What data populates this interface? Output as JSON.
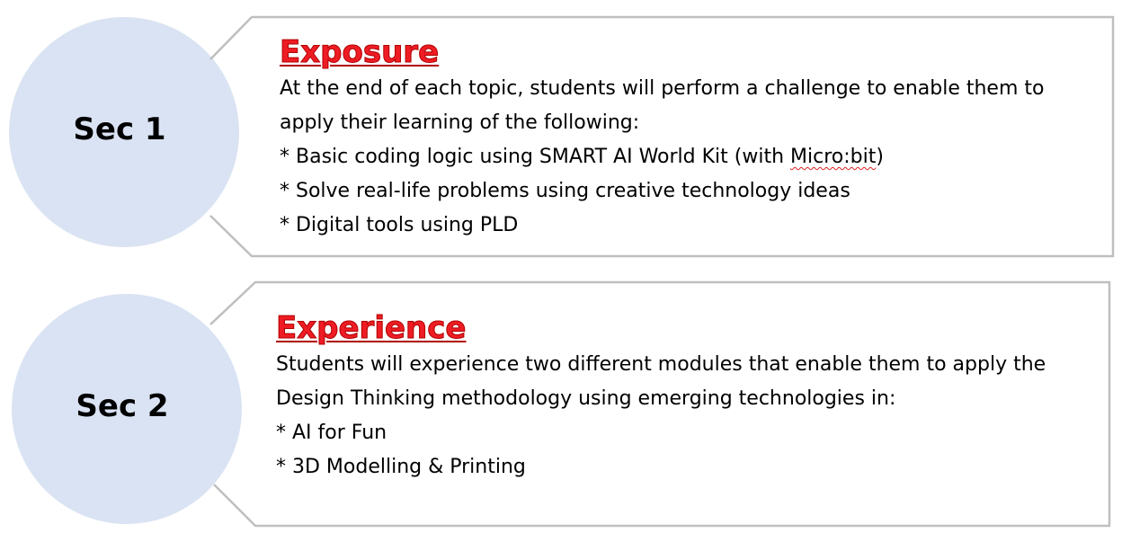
{
  "sections": [
    {
      "circle_label": "Sec 1",
      "title": "Exposure",
      "intro_1": "At the end of each topic, students will perform a challenge to enable them to",
      "intro_2": "apply their learning of the following:",
      "bullet_1_pre": "* Basic coding logic using SMART AI World Kit (with ",
      "bullet_1_flagged": "Micro:bit",
      "bullet_1_post": ")",
      "bullet_2": "* Solve real-life problems using creative technology ideas",
      "bullet_3": "* Digital tools using PLD"
    },
    {
      "circle_label": "Sec 2",
      "title": "Experience",
      "intro_1": "Students will experience two different modules that enable them to apply the",
      "intro_2": "Design Thinking methodology using emerging technologies in:",
      "bullet_1": "* AI for Fun",
      "bullet_2": "* 3D Modelling & Printing"
    }
  ],
  "colors": {
    "circle_fill": "#dae3f3",
    "title_red": "#ee1c24",
    "frame_stroke": "#bfbfbf"
  }
}
